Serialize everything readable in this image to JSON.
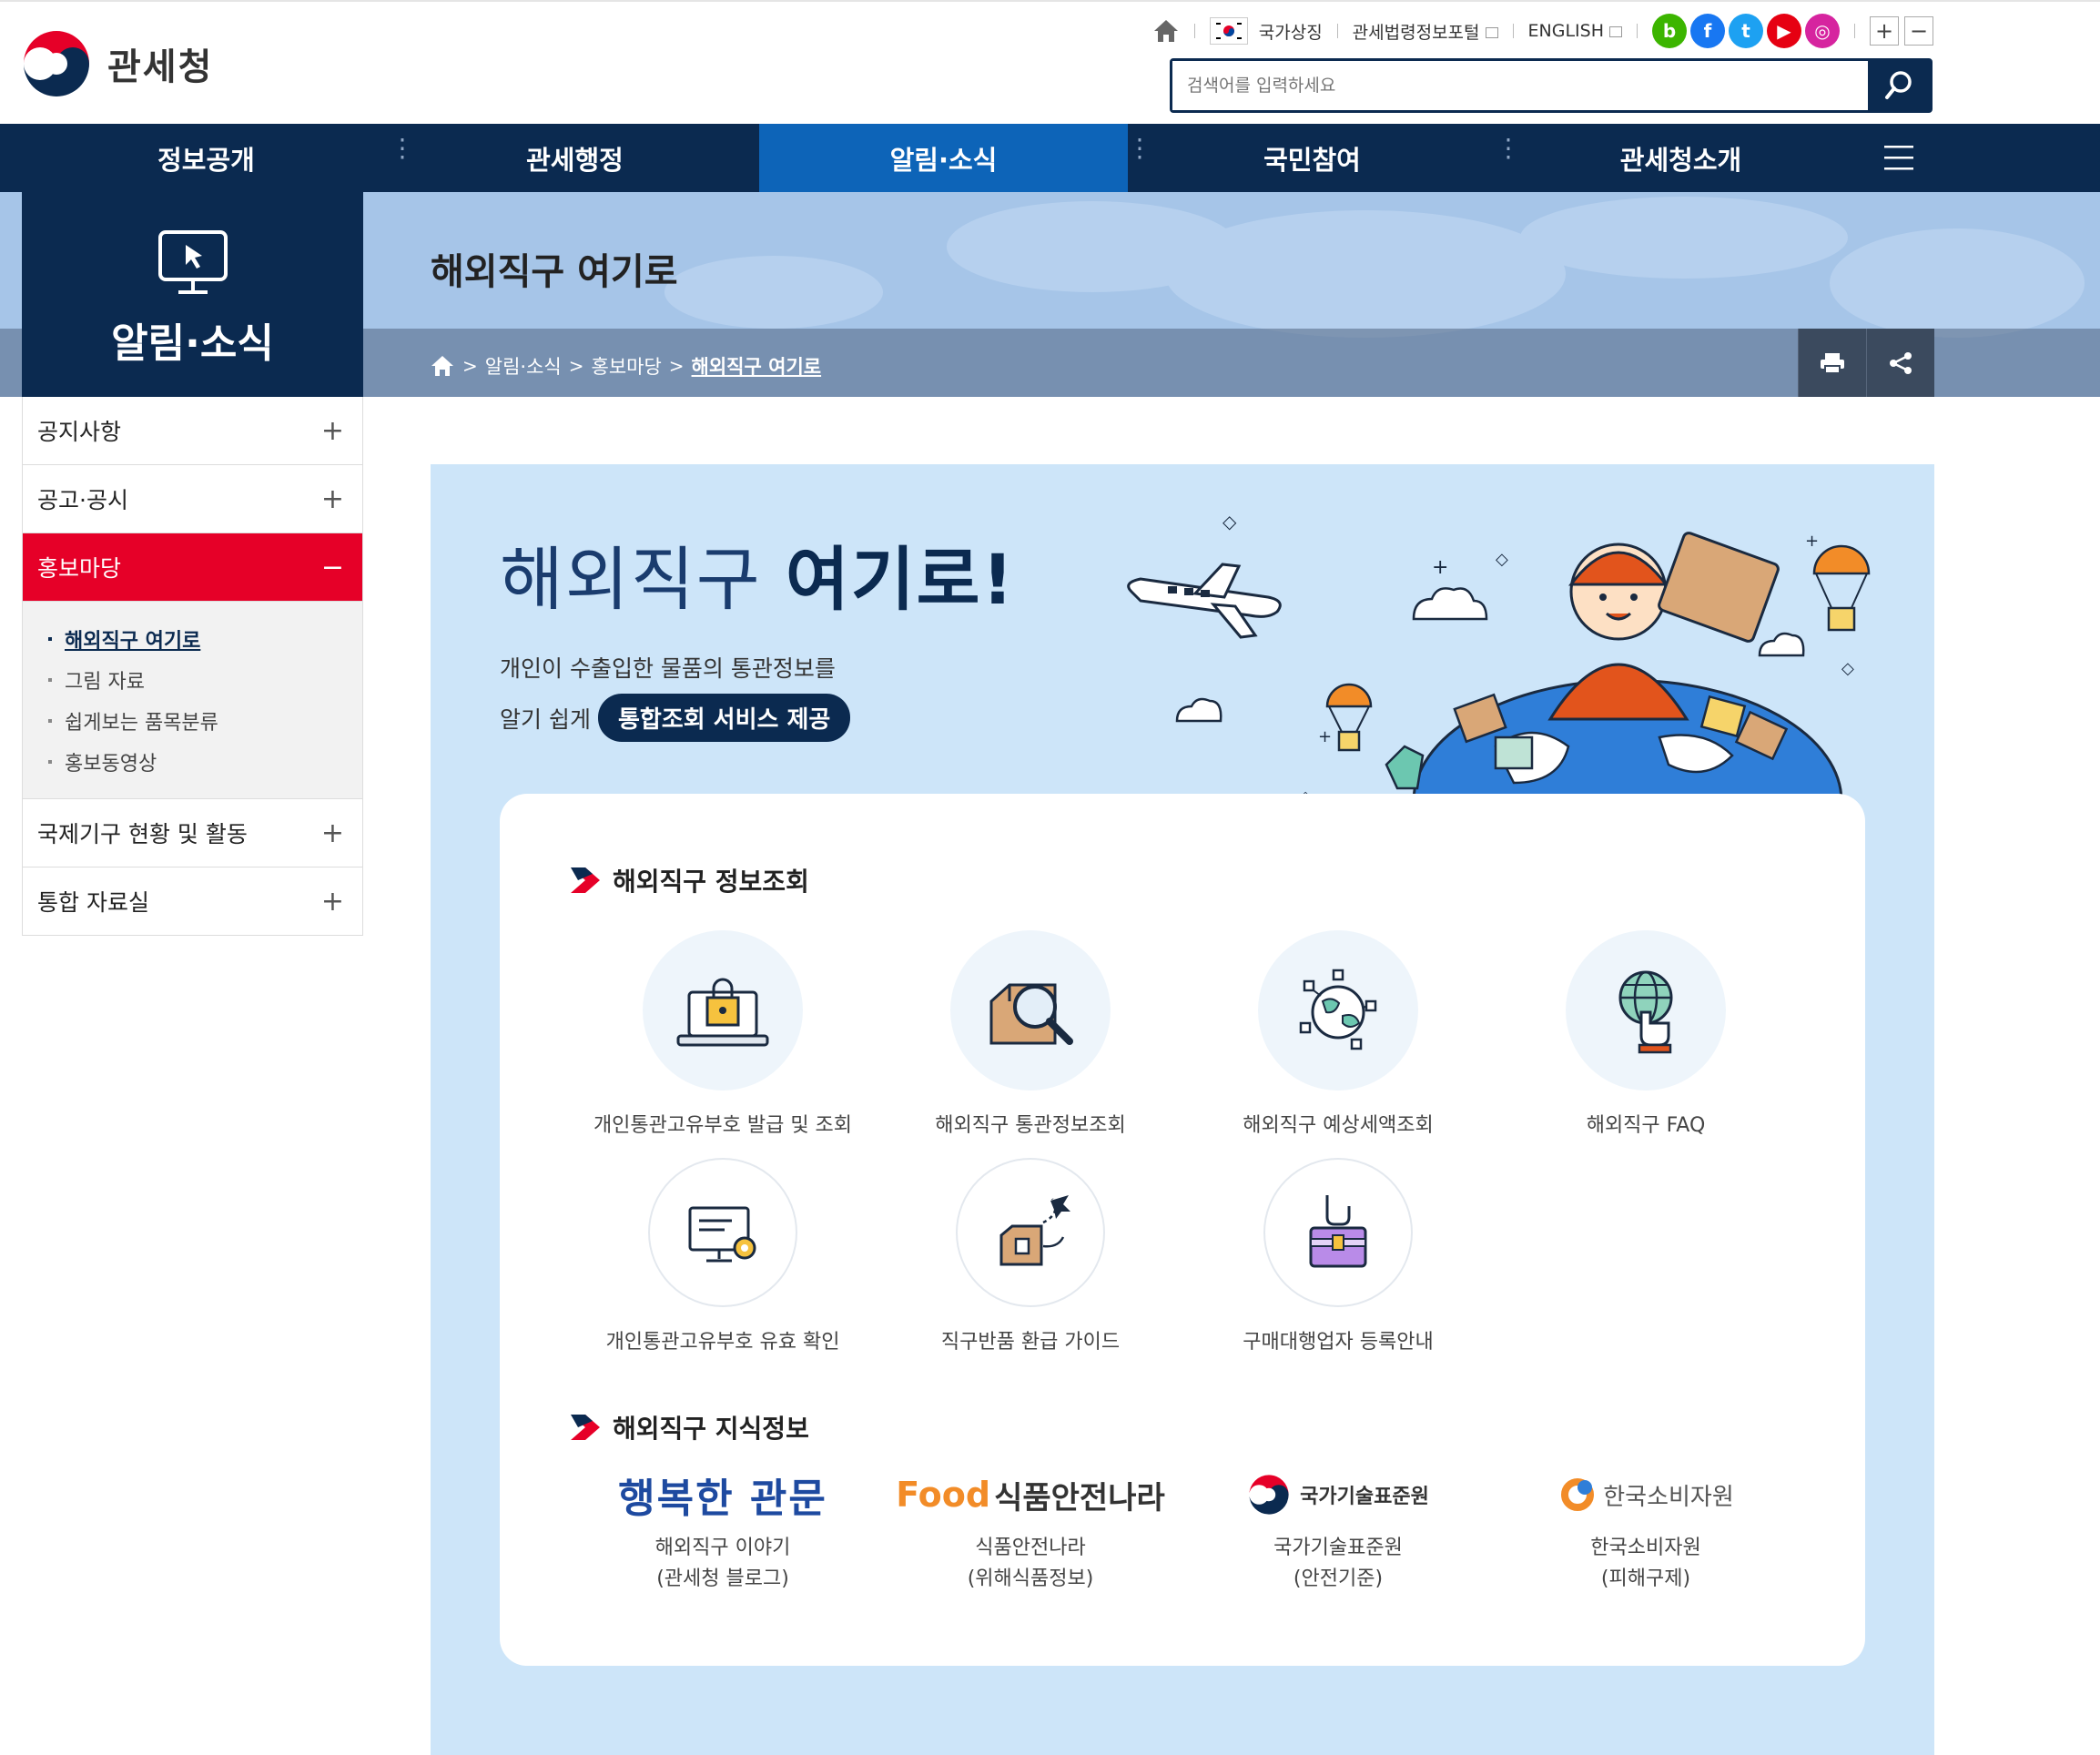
{
  "header": {
    "logo_text": "관세청",
    "utility": {
      "national_symbol": "국가상징",
      "law_portal": "관세법령정보포털",
      "english": "ENGLISH"
    },
    "sns": [
      {
        "name": "blog-icon",
        "glyph": "b",
        "color": "#3cb500"
      },
      {
        "name": "facebook-icon",
        "glyph": "f",
        "color": "#1877f2"
      },
      {
        "name": "twitter-icon",
        "glyph": "t",
        "color": "#1da1f2"
      },
      {
        "name": "youtube-icon",
        "glyph": "▶",
        "color": "#e60012"
      },
      {
        "name": "instagram-icon",
        "glyph": "◎",
        "color": "#d6249f"
      }
    ],
    "zoom_in": "+",
    "zoom_out": "−",
    "search_placeholder": "검색어를 입력하세요"
  },
  "gnb": {
    "items": [
      "정보공개",
      "관세행정",
      "알림·소식",
      "국민참여",
      "관세청소개"
    ],
    "active_index": 2
  },
  "subvisual": {
    "page_title": "해외직구 여기로",
    "breadcrumb": [
      "알림·소식",
      "홍보마당",
      "해외직구 여기로"
    ]
  },
  "lnb": {
    "title": "알림·소식",
    "items": [
      "공지사항",
      "공고·공시",
      "홍보마당",
      "국제기구 현황 및 활동",
      "통합 자료실"
    ],
    "active": "홍보마당",
    "sub_items": [
      "해외직구 여기로",
      "그림 자료",
      "쉽게보는 품목분류",
      "홍보동영상"
    ],
    "active_sub": "해외직구 여기로"
  },
  "hero": {
    "title_light": "해외직구 ",
    "title_bold": "여기로!",
    "desc_line1": "개인이 수출입한 물품의 통관정보를",
    "desc_line2": "알기 쉽게",
    "pill": "통합조회 서비스 제공"
  },
  "info_section": {
    "title": "해외직구 정보조회",
    "services": [
      "개인통관고유부호 발급 및 조회",
      "해외직구 통관정보조회",
      "해외직구 예상세액조회",
      "해외직구 FAQ",
      "개인통관고유부호 유효 확인",
      "직구반품 환급 가이드",
      "구매대행업자 등록안내"
    ]
  },
  "knowledge_section": {
    "title": "해외직구 지식정보",
    "items": [
      {
        "logo": "행복한 관문",
        "line1": "해외직구 이야기",
        "line2": "(관세청 블로그)"
      },
      {
        "logo_prefix": "Food",
        "logo": "식품안전나라",
        "line1": "식품안전나라",
        "line2": "(위해식품정보)"
      },
      {
        "logo": "국가기술표준원",
        "line1": "국가기술표준원",
        "line2": "(안전기준)"
      },
      {
        "logo": "한국소비자원",
        "line1": "한국소비자원",
        "line2": "(피해구제)"
      }
    ]
  },
  "colors": {
    "navy": "#0b2a50",
    "active_blue": "#0d64b8",
    "red": "#e60028",
    "content_bg": "#cde5f9"
  }
}
